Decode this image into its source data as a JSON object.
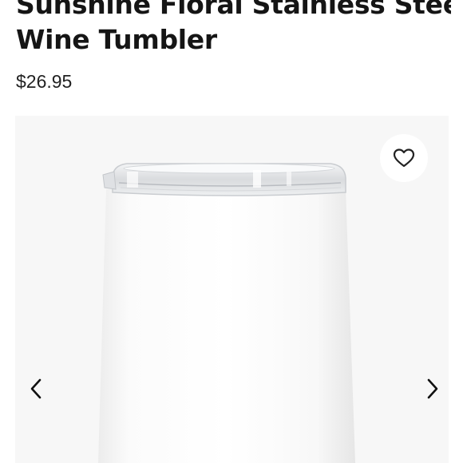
{
  "product": {
    "title_line1": "Sunshine Floral Stainless Steel",
    "title_line2": "Wine Tumbler",
    "price": "$26.95"
  },
  "gallery": {
    "icons": {
      "favorite": "heart-outline-icon",
      "previous": "chevron-left-icon",
      "next": "chevron-right-icon"
    },
    "colors": {
      "background": "#f7f7f7",
      "tumbler_body": "#ffffff",
      "lid": "#e9eaec"
    }
  }
}
